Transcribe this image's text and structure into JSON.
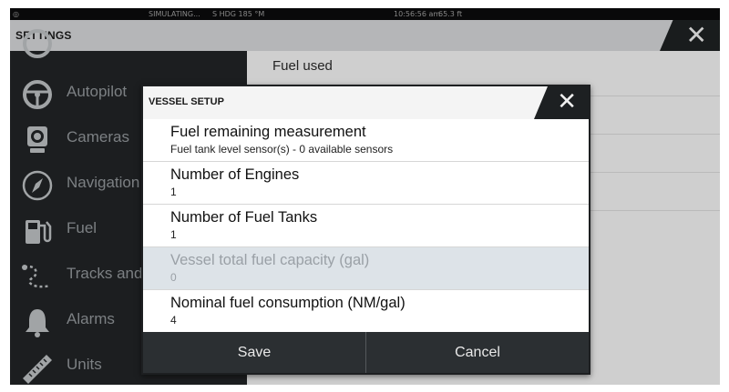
{
  "status_bar": {
    "mode": "SIMULATING...",
    "heading": "S HDG 185 °M",
    "time": "10:56:56 am",
    "depth": "65.3 ft"
  },
  "settings": {
    "title": "SETTINGS",
    "close_glyph": "✕"
  },
  "sidebar": {
    "items": [
      {
        "label": "",
        "icon": "partial-icon"
      },
      {
        "label": "Autopilot",
        "icon": "steering-wheel-icon"
      },
      {
        "label": "Cameras",
        "icon": "camera-icon"
      },
      {
        "label": "Navigation",
        "icon": "compass-icon"
      },
      {
        "label": "Fuel",
        "icon": "fuel-pump-icon"
      },
      {
        "label": "Tracks and",
        "icon": "tracks-icon"
      },
      {
        "label": "Alarms",
        "icon": "bell-icon"
      },
      {
        "label": "Units",
        "icon": "ruler-icon"
      }
    ]
  },
  "right_panel": {
    "fuel_used_label": "Fuel used"
  },
  "modal": {
    "title": "VESSEL SETUP",
    "close_glyph": "✕",
    "fields": [
      {
        "label": "Fuel remaining measurement",
        "value": "Fuel tank level sensor(s) - 0 available sensors",
        "disabled": false
      },
      {
        "label": "Number of Engines",
        "value": "1",
        "disabled": false
      },
      {
        "label": "Number of Fuel Tanks",
        "value": "1",
        "disabled": false
      },
      {
        "label": "Vessel total fuel capacity (gal)",
        "value": "0",
        "disabled": true
      },
      {
        "label": "Nominal fuel consumption (NM/gal)",
        "value": "4",
        "disabled": false
      }
    ],
    "save_label": "Save",
    "cancel_label": "Cancel"
  },
  "colors": {
    "dark_background": "#1a1c1e",
    "header_gray": "#cfd0d2",
    "disabled_field": "#dde3e8",
    "footer_bar": "#2b2f32"
  }
}
